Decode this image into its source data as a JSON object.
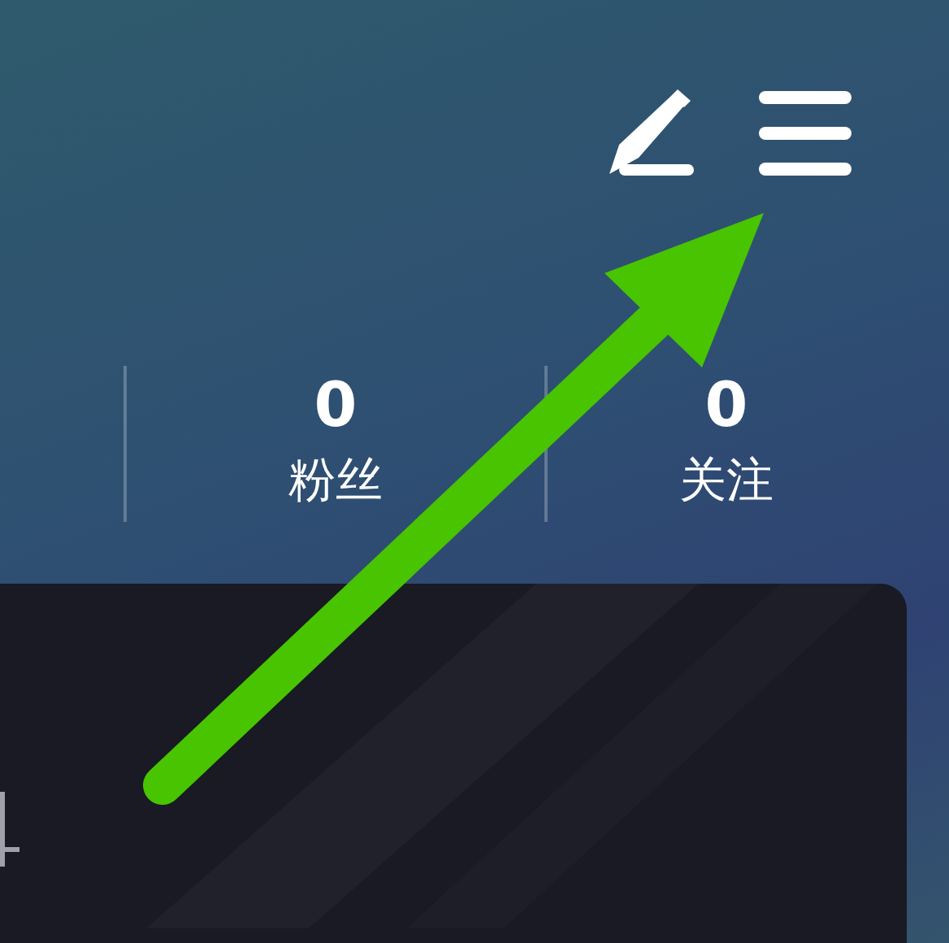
{
  "stats": [
    {
      "value": "0",
      "label": "粉丝"
    },
    {
      "value": "0",
      "label": "关注"
    }
  ]
}
